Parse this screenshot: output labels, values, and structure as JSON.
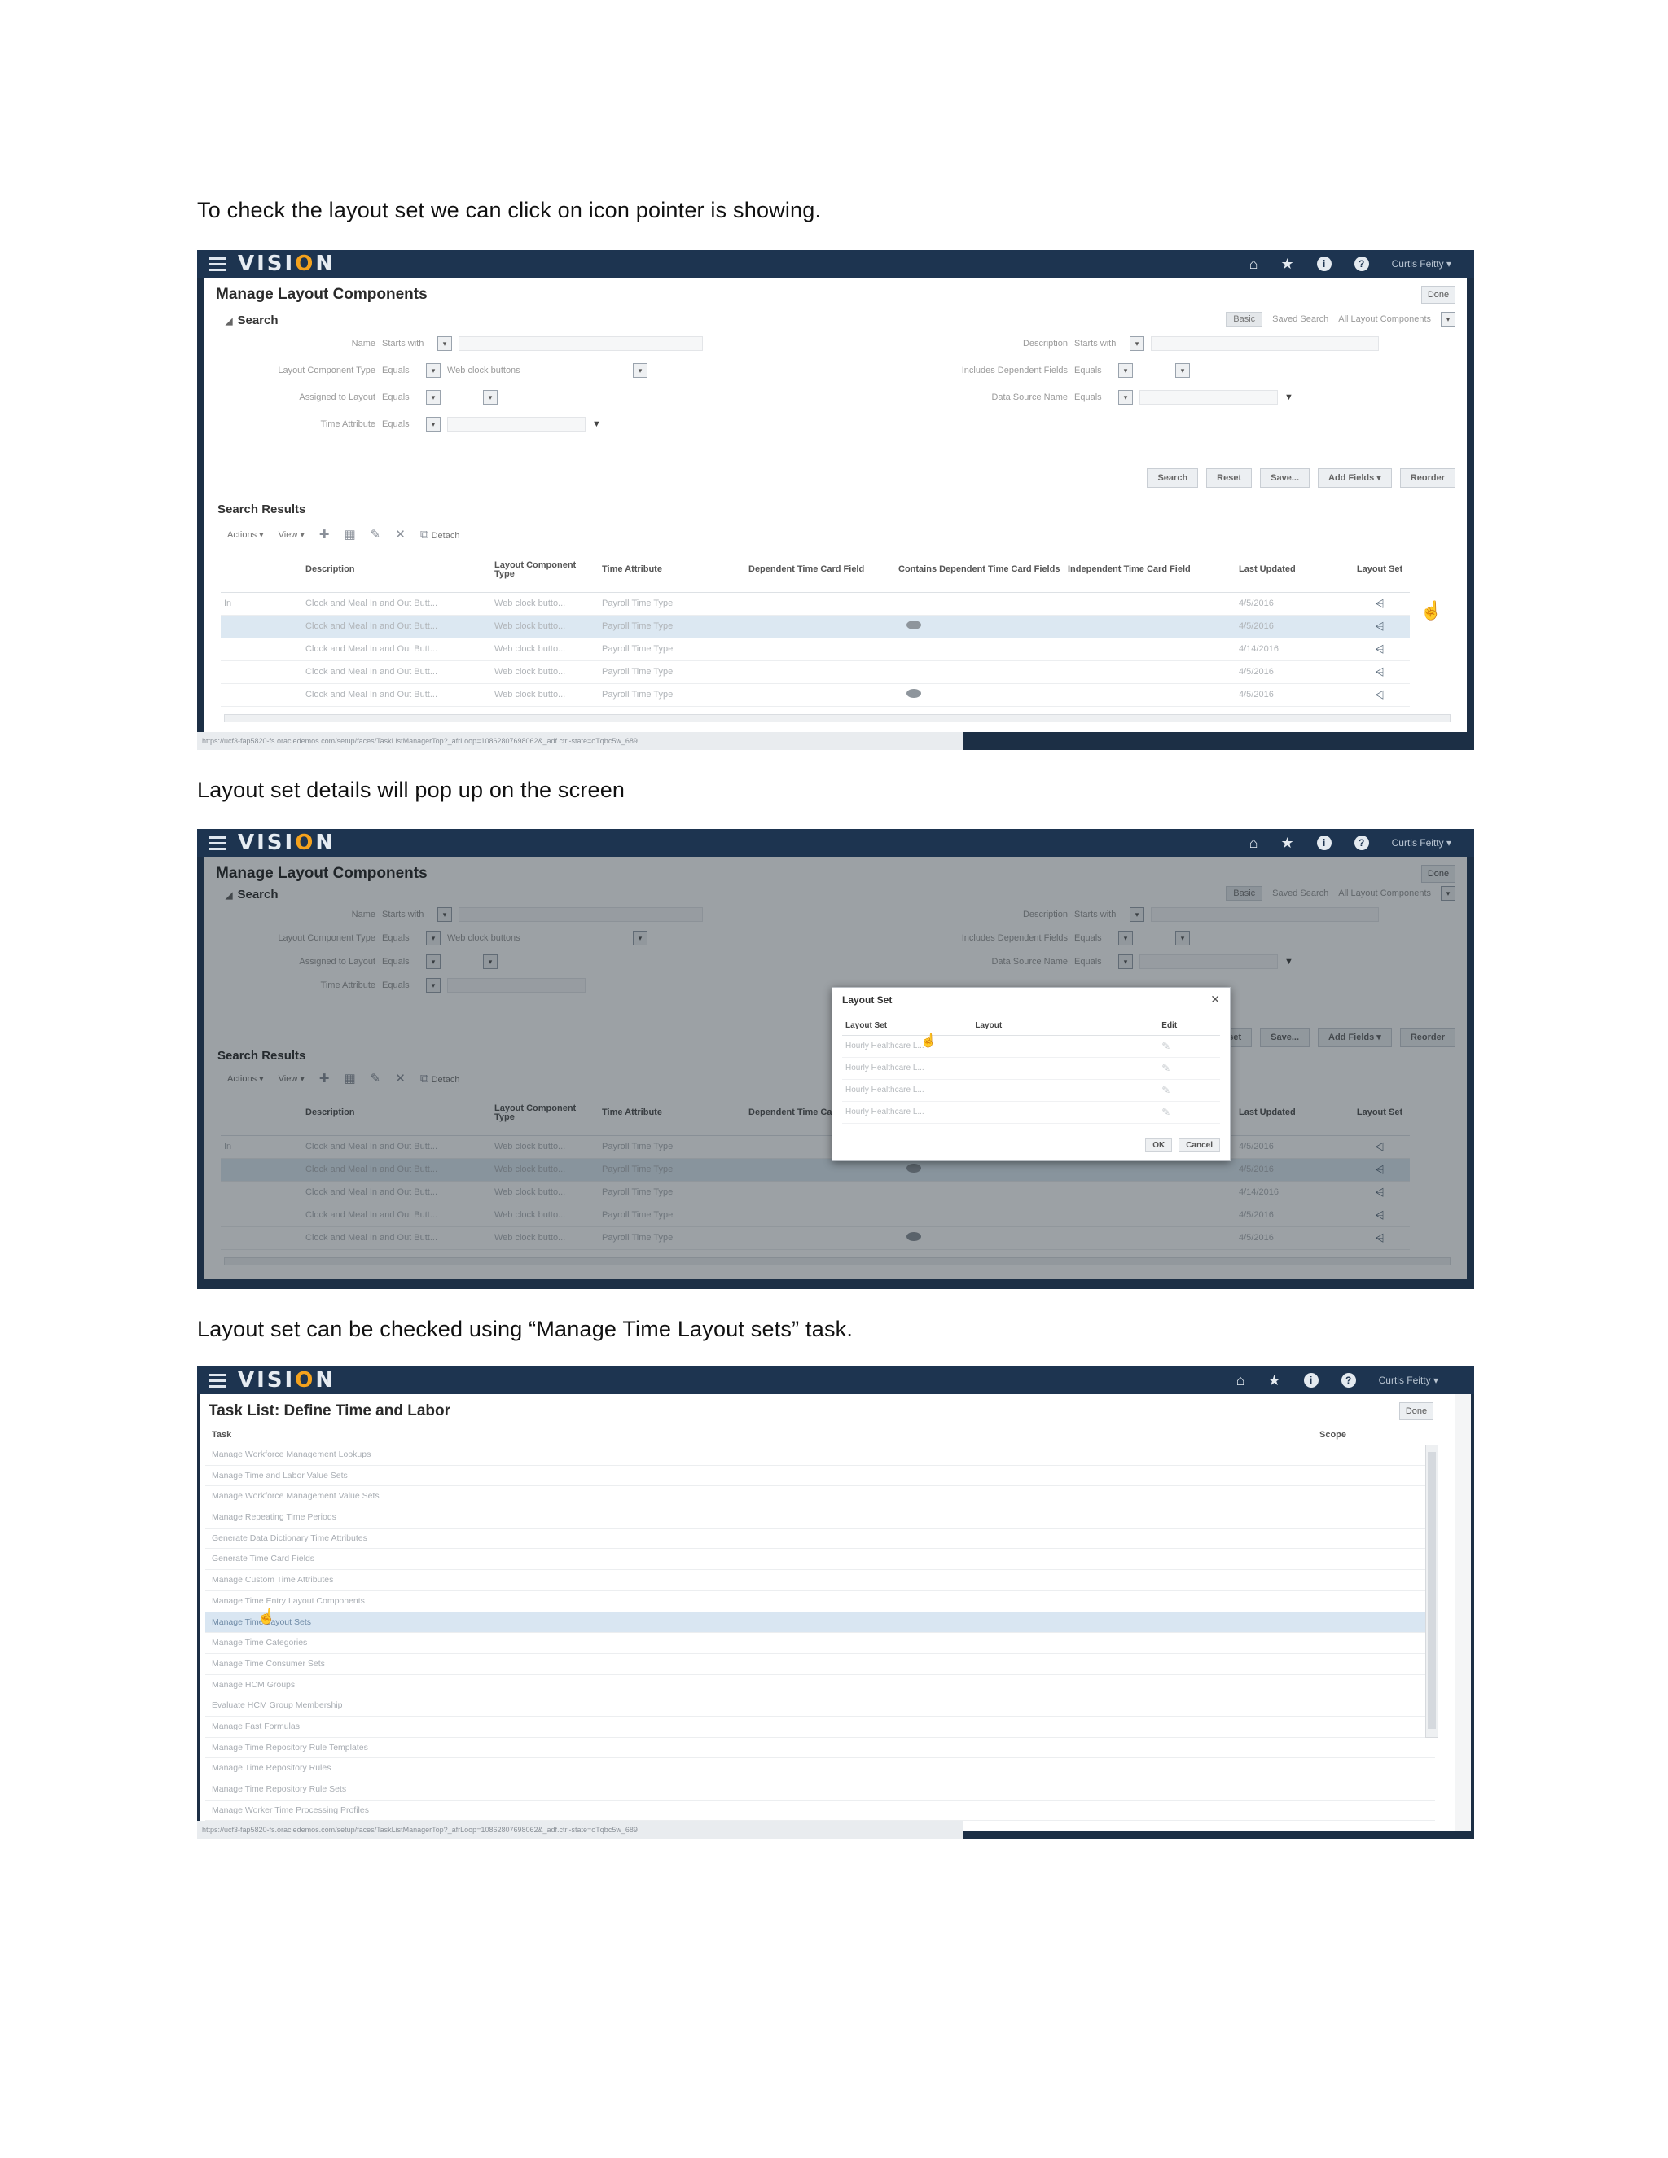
{
  "captions": {
    "c1": "To check the layout set we can click on icon pointer is showing.",
    "c2": "Layout set details will pop up on the screen",
    "c3": "Layout set can be checked using “Manage Time Layout sets” task."
  },
  "app": {
    "logo_pre": "VISI",
    "logo_o": "O",
    "logo_post": "N",
    "user": "Curtis Feitty ▾",
    "home_icon": "⌂",
    "star_icon": "★",
    "info_icon": "i",
    "help_icon": "?",
    "done": "Done",
    "url": "https://ucf3-fap5820-fs.oracledemos.com/setup/faces/TaskListManagerTop?_afrLoop=10862807698062&_adf.ctrl-state=oTqbc5w_689"
  },
  "shot1": {
    "title": "Manage Layout Components",
    "search_label": "Search",
    "basic": "Basic",
    "saved_search_label": "Saved Search",
    "saved_search_value": "All Layout Components",
    "filters": {
      "name": "Name",
      "name_op": "Starts with",
      "type": "Layout Component Type",
      "type_op": "Equals",
      "type_val": "Web clock buttons",
      "assigned": "Assigned to Layout",
      "assigned_op": "Equals",
      "time_attr": "Time Attribute",
      "time_attr_op": "Equals",
      "description": "Description",
      "description_op": "Starts with",
      "includes": "Includes Dependent Fields",
      "includes_op": "Equals",
      "datasource": "Data Source Name",
      "datasource_op": "Equals"
    },
    "buttons": [
      "Search",
      "Reset",
      "Save...",
      "Add Fields ▾",
      "Reorder"
    ],
    "results_label": "Search Results",
    "toolbar": {
      "actions": "Actions ▾",
      "view": "View ▾",
      "detach": "Detach"
    },
    "columns": [
      "",
      "Description",
      "Layout Component Type",
      "Time Attribute",
      "Dependent Time Card Field",
      "Contains Dependent Time Card Fields",
      "Independent Time Card Field",
      "Last Updated",
      "Layout Set"
    ],
    "rows": [
      {
        "c0": "In",
        "desc": "Clock and Meal In and Out Butt...",
        "type": "Web clock butto...",
        "attr": "Payroll Time Type",
        "eye": false,
        "date": "4/5/2016"
      },
      {
        "c0": "",
        "desc": "Clock and Meal In and Out Butt...",
        "type": "Web clock butto...",
        "attr": "Payroll Time Type",
        "eye": true,
        "date": "4/5/2016"
      },
      {
        "c0": "",
        "desc": "Clock and Meal In and Out Butt...",
        "type": "Web clock butto...",
        "attr": "Payroll Time Type",
        "eye": false,
        "date": "4/14/2016"
      },
      {
        "c0": "",
        "desc": "Clock and Meal In and Out Butt...",
        "type": "Web clock butto...",
        "attr": "Payroll Time Type",
        "eye": false,
        "date": "4/5/2016"
      },
      {
        "c0": "",
        "desc": "Clock and Meal In and Out Butt...",
        "type": "Web clock butto...",
        "attr": "Payroll Time Type",
        "eye": true,
        "date": "4/5/2016"
      }
    ],
    "layout_set_icon": "⩤"
  },
  "shot2": {
    "dialog": {
      "title": "Layout Set",
      "close": "✕",
      "columns": [
        "Layout Set",
        "Layout",
        "Edit"
      ],
      "rows": [
        "Hourly Healthcare L...",
        "Hourly Healthcare L...",
        "Hourly Healthcare L...",
        "Hourly Healthcare L..."
      ],
      "ok": "OK",
      "cancel": "Cancel"
    }
  },
  "shot3": {
    "title": "Task List: Define Time and Labor",
    "col_task": "Task",
    "col_scope": "Scope",
    "tasks": [
      "Manage Workforce Management Lookups",
      "Manage Time and Labor Value Sets",
      "Manage Workforce Management Value Sets",
      "Manage Repeating Time Periods",
      "Generate Data Dictionary Time Attributes",
      "Generate Time Card Fields",
      "Manage Custom Time Attributes",
      "Manage Time Entry Layout Components",
      "Manage Time Layout Sets",
      "Manage Time Categories",
      "Manage Time Consumer Sets",
      "Manage HCM Groups",
      "Evaluate HCM Group Membership",
      "Manage Fast Formulas",
      "Manage Time Repository Rule Templates",
      "Manage Time Repository Rules",
      "Manage Time Repository Rule Sets",
      "Manage Worker Time Processing Profiles"
    ],
    "selected_index": 8
  }
}
